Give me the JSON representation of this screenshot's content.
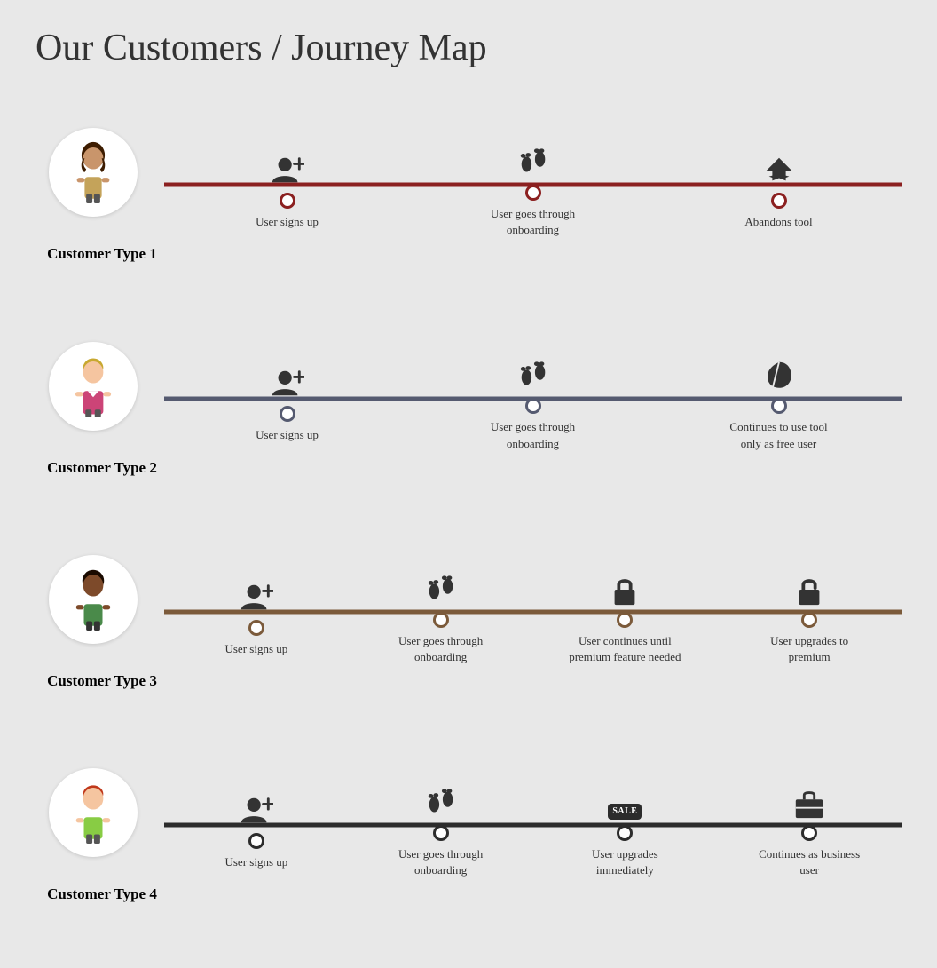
{
  "title": {
    "bold": "Our Customers",
    "light": " / Journey Map"
  },
  "rows": [
    {
      "id": "row1",
      "label": "Customer Type 1",
      "color": "#8b2020",
      "avatar_color": "#c4a080",
      "avatar_type": "woman_brown",
      "steps": [
        {
          "icon": "user-plus",
          "label": "User signs up"
        },
        {
          "icon": "footprints",
          "label": "User goes through onboarding"
        },
        {
          "icon": "airplane",
          "label": "Abandons tool"
        }
      ]
    },
    {
      "id": "row2",
      "label": "Customer Type 2",
      "color": "#555a70",
      "avatar_type": "man_blonde",
      "steps": [
        {
          "icon": "user-plus",
          "label": "User signs up"
        },
        {
          "icon": "footprints",
          "label": "User goes through onboarding"
        },
        {
          "icon": "leaf",
          "label": "Continues to use tool only as free user"
        }
      ]
    },
    {
      "id": "row3",
      "label": "Customer Type 3",
      "color": "#7b5a3a",
      "avatar_type": "woman_dark",
      "steps": [
        {
          "icon": "user-plus",
          "label": "User signs up"
        },
        {
          "icon": "footprints",
          "label": "User goes through onboarding"
        },
        {
          "icon": "lock",
          "label": "User continues until premium feature needed"
        },
        {
          "icon": "lock-open",
          "label": "User upgrades to premium"
        }
      ]
    },
    {
      "id": "row4",
      "label": "Customer Type 4",
      "color": "#2c2c2c",
      "avatar_type": "man_red",
      "steps": [
        {
          "icon": "user-plus",
          "label": "User signs up"
        },
        {
          "icon": "footprints",
          "label": "User goes through onboarding"
        },
        {
          "icon": "sale",
          "label": "User upgrades immediately"
        },
        {
          "icon": "briefcase",
          "label": "Continues as business user"
        }
      ]
    }
  ]
}
